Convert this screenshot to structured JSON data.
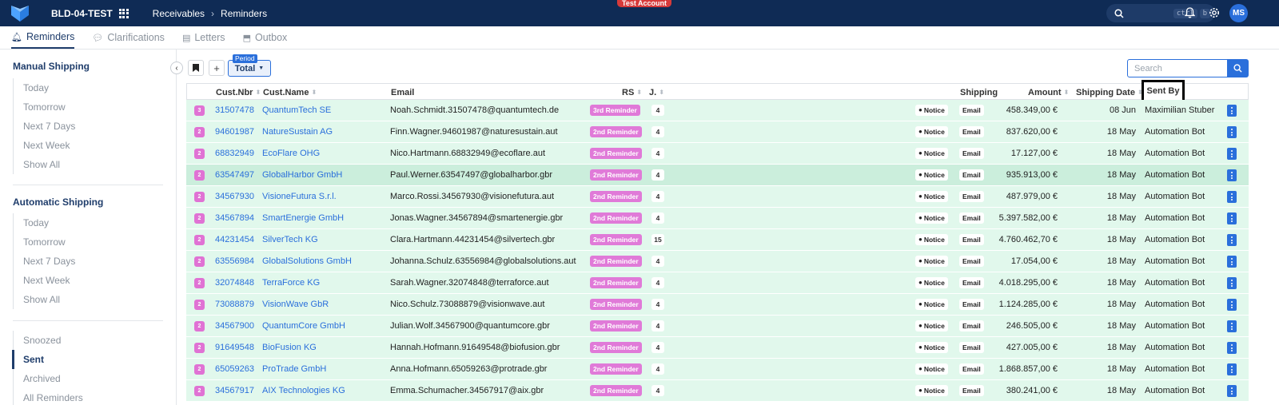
{
  "header": {
    "env_name": "BLD-04-TEST",
    "breadcrumb": [
      "Receivables",
      "Reminders"
    ],
    "test_badge": "Test Account",
    "shortcut_keys": [
      "ctrl",
      "b"
    ],
    "avatar_initials": "MS"
  },
  "tabs": [
    {
      "label": "Reminders",
      "active": true,
      "icon": "bell-icon"
    },
    {
      "label": "Clarifications",
      "active": false,
      "icon": "chat-icon"
    },
    {
      "label": "Letters",
      "active": false,
      "icon": "printer-icon"
    },
    {
      "label": "Outbox",
      "active": false,
      "icon": "outbox-icon"
    }
  ],
  "sidebar": {
    "manual": {
      "title": "Manual Shipping",
      "items": [
        "Today",
        "Tomorrow",
        "Next 7 Days",
        "Next Week",
        "Show All"
      ]
    },
    "automatic": {
      "title": "Automatic Shipping",
      "items": [
        "Today",
        "Tomorrow",
        "Next 7 Days",
        "Next Week",
        "Show All"
      ]
    },
    "other": {
      "items": [
        "Snoozed",
        "Sent",
        "Archived",
        "All Reminders"
      ],
      "active": "Sent"
    }
  },
  "toolbar": {
    "add_label": "+",
    "period_label": "Period",
    "period_value": "Total",
    "search_placeholder": "Search"
  },
  "table": {
    "columns": {
      "cust_nbr": "Cust.Nbr",
      "cust_name": "Cust.Name",
      "email": "Email",
      "rs": "RS",
      "j": "J.",
      "shipping": "Shipping",
      "amount": "Amount",
      "shipping_date": "Shipping Date",
      "sent_by": "Sent By"
    },
    "rows": [
      {
        "level": "3",
        "nbr": "31507478",
        "name": "QuantumTech SE",
        "email": "Noah.Schmidt.31507478@quantumtech.de",
        "rs": "3rd Reminder",
        "j": "4",
        "notice": "Notice",
        "channel": "Email",
        "amount": "458.349,00 €",
        "date": "08 Jun",
        "sent_by": "Maximilian Stuber"
      },
      {
        "level": "2",
        "nbr": "94601987",
        "name": "NatureSustain AG",
        "email": "Finn.Wagner.94601987@naturesustain.aut",
        "rs": "2nd Reminder",
        "j": "4",
        "notice": "Notice",
        "channel": "Email",
        "amount": "837.620,00 €",
        "date": "18 May",
        "sent_by": "Automation Bot"
      },
      {
        "level": "2",
        "nbr": "68832949",
        "name": "EcoFlare OHG",
        "email": "Nico.Hartmann.68832949@ecoflare.aut",
        "rs": "2nd Reminder",
        "j": "4",
        "notice": "Notice",
        "channel": "Email",
        "amount": "17.127,00 €",
        "date": "18 May",
        "sent_by": "Automation Bot"
      },
      {
        "level": "2",
        "nbr": "63547497",
        "name": "GlobalHarbor GmbH",
        "email": "Paul.Werner.63547497@globalharbor.gbr",
        "rs": "2nd Reminder",
        "j": "4",
        "notice": "Notice",
        "channel": "Email",
        "amount": "935.913,00 €",
        "date": "18 May",
        "sent_by": "Automation Bot"
      },
      {
        "level": "2",
        "nbr": "34567930",
        "name": "VisioneFutura S.r.l.",
        "email": "Marco.Rossi.34567930@visionefutura.aut",
        "rs": "2nd Reminder",
        "j": "4",
        "notice": "Notice",
        "channel": "Email",
        "amount": "487.979,00 €",
        "date": "18 May",
        "sent_by": "Automation Bot"
      },
      {
        "level": "2",
        "nbr": "34567894",
        "name": "SmartEnergie GmbH",
        "email": "Jonas.Wagner.34567894@smartenergie.gbr",
        "rs": "2nd Reminder",
        "j": "4",
        "notice": "Notice",
        "channel": "Email",
        "amount": "5.397.582,00 €",
        "date": "18 May",
        "sent_by": "Automation Bot"
      },
      {
        "level": "2",
        "nbr": "44231454",
        "name": "SilverTech KG",
        "email": "Clara.Hartmann.44231454@silvertech.gbr",
        "rs": "2nd Reminder",
        "j": "15",
        "notice": "Notice",
        "channel": "Email",
        "amount": "4.760.462,70 €",
        "date": "18 May",
        "sent_by": "Automation Bot"
      },
      {
        "level": "2",
        "nbr": "63556984",
        "name": "GlobalSolutions GmbH",
        "email": "Johanna.Schulz.63556984@globalsolutions.aut",
        "rs": "2nd Reminder",
        "j": "4",
        "notice": "Notice",
        "channel": "Email",
        "amount": "17.054,00 €",
        "date": "18 May",
        "sent_by": "Automation Bot"
      },
      {
        "level": "2",
        "nbr": "32074848",
        "name": "TerraForce KG",
        "email": "Sarah.Wagner.32074848@terraforce.aut",
        "rs": "2nd Reminder",
        "j": "4",
        "notice": "Notice",
        "channel": "Email",
        "amount": "4.018.295,00 €",
        "date": "18 May",
        "sent_by": "Automation Bot"
      },
      {
        "level": "2",
        "nbr": "73088879",
        "name": "VisionWave GbR",
        "email": "Nico.Schulz.73088879@visionwave.aut",
        "rs": "2nd Reminder",
        "j": "4",
        "notice": "Notice",
        "channel": "Email",
        "amount": "1.124.285,00 €",
        "date": "18 May",
        "sent_by": "Automation Bot"
      },
      {
        "level": "2",
        "nbr": "34567900",
        "name": "QuantumCore GmbH",
        "email": "Julian.Wolf.34567900@quantumcore.gbr",
        "rs": "2nd Reminder",
        "j": "4",
        "notice": "Notice",
        "channel": "Email",
        "amount": "246.505,00 €",
        "date": "18 May",
        "sent_by": "Automation Bot"
      },
      {
        "level": "2",
        "nbr": "91649548",
        "name": "BioFusion KG",
        "email": "Hannah.Hofmann.91649548@biofusion.gbr",
        "rs": "2nd Reminder",
        "j": "4",
        "notice": "Notice",
        "channel": "Email",
        "amount": "427.005,00 €",
        "date": "18 May",
        "sent_by": "Automation Bot"
      },
      {
        "level": "2",
        "nbr": "65059263",
        "name": "ProTrade GmbH",
        "email": "Anna.Hofmann.65059263@protrade.gbr",
        "rs": "2nd Reminder",
        "j": "4",
        "notice": "Notice",
        "channel": "Email",
        "amount": "1.868.857,00 €",
        "date": "18 May",
        "sent_by": "Automation Bot"
      },
      {
        "level": "2",
        "nbr": "34567917",
        "name": "AIX Technologies KG",
        "email": "Emma.Schumacher.34567917@aix.gbr",
        "rs": "2nd Reminder",
        "j": "4",
        "notice": "Notice",
        "channel": "Email",
        "amount": "380.241,00 €",
        "date": "18 May",
        "sent_by": "Automation Bot"
      }
    ],
    "highlighted_row": 3
  },
  "colors": {
    "nav_bg": "#0f2b55",
    "accent": "#2a6fdb",
    "row_bg": "#e1f8ec",
    "row_hover": "#cbeedc",
    "reminder_badge": "#e07ad8",
    "test_badge": "#d63a3a"
  }
}
